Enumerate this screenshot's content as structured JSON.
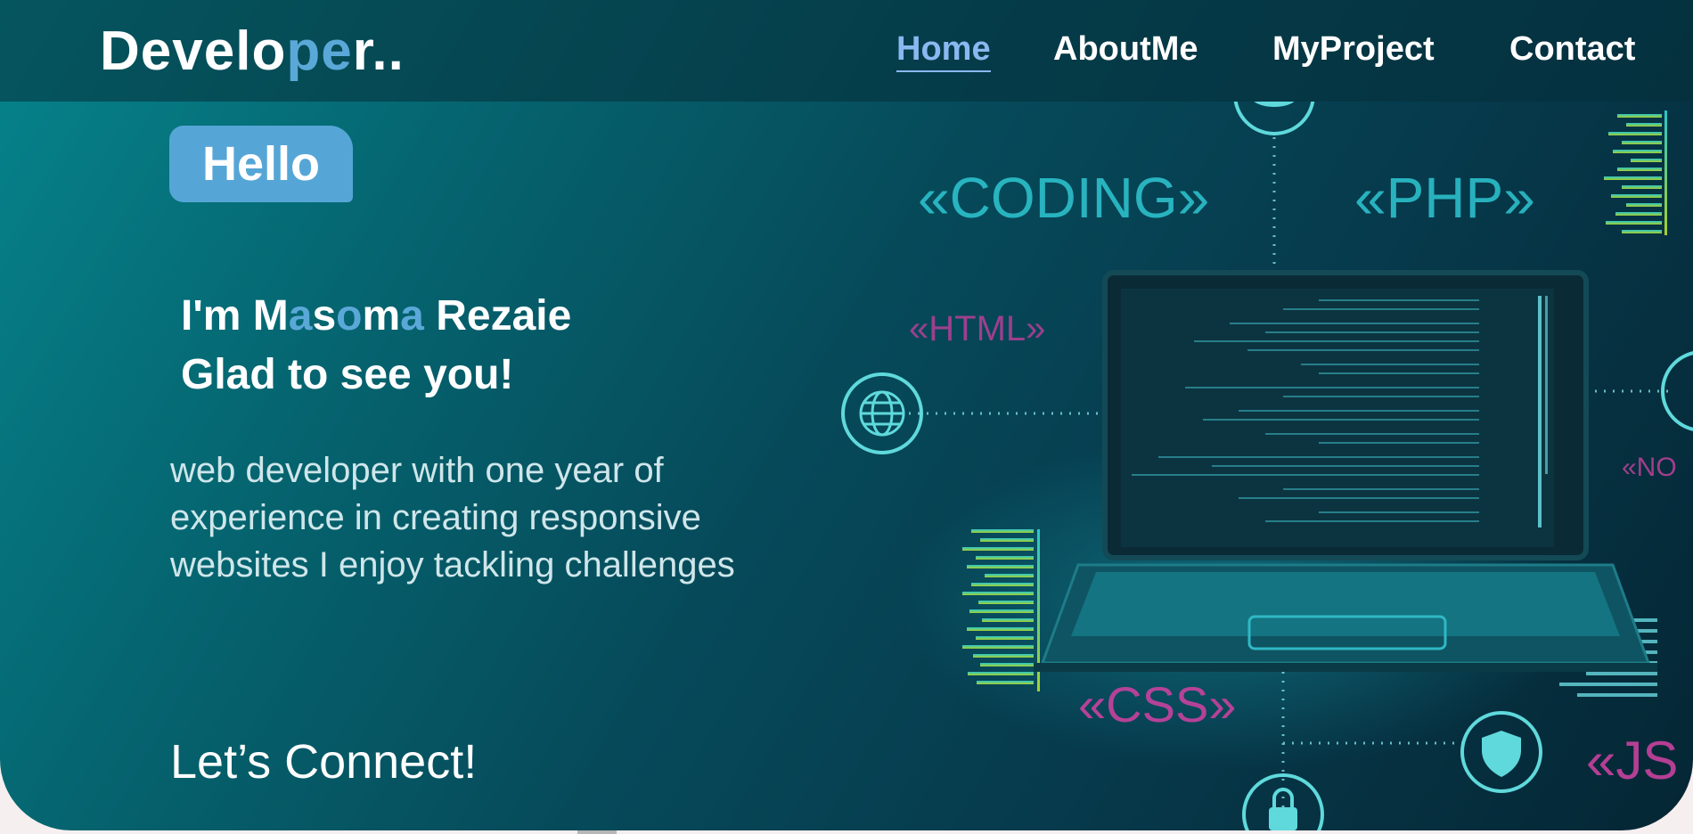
{
  "brand": {
    "part1": "Develo",
    "part2": "pe",
    "part3": "r.."
  },
  "nav": [
    {
      "label": "Home",
      "active": true
    },
    {
      "label": "AboutMe",
      "active": false
    },
    {
      "label": "MyProject",
      "active": false
    },
    {
      "label": "Contact",
      "active": false
    }
  ],
  "hero": {
    "hello": "Hello",
    "intro_line1_parts": [
      "I'm M",
      "a",
      "s",
      "o",
      "m",
      "a",
      " Rezaie"
    ],
    "intro_line2": "Glad to see you!",
    "description": "web developer with one year of experience in creating responsive websites I enjoy tackling challenges",
    "connect": "Let’s Connect!"
  },
  "art_labels": {
    "coding": "«CODING»",
    "php": "«PHP»",
    "html": "«HTML»",
    "css": "«CSS»",
    "json": "«NO",
    "js": "«JS"
  },
  "colors": {
    "accent": "#5aa8d8",
    "nav_active": "#8ab8f0",
    "hero_gradient_start": "#06848c",
    "hero_gradient_end": "#052634",
    "neon_magenta": "#d2338f",
    "neon_cyan": "#2fd5d5"
  }
}
